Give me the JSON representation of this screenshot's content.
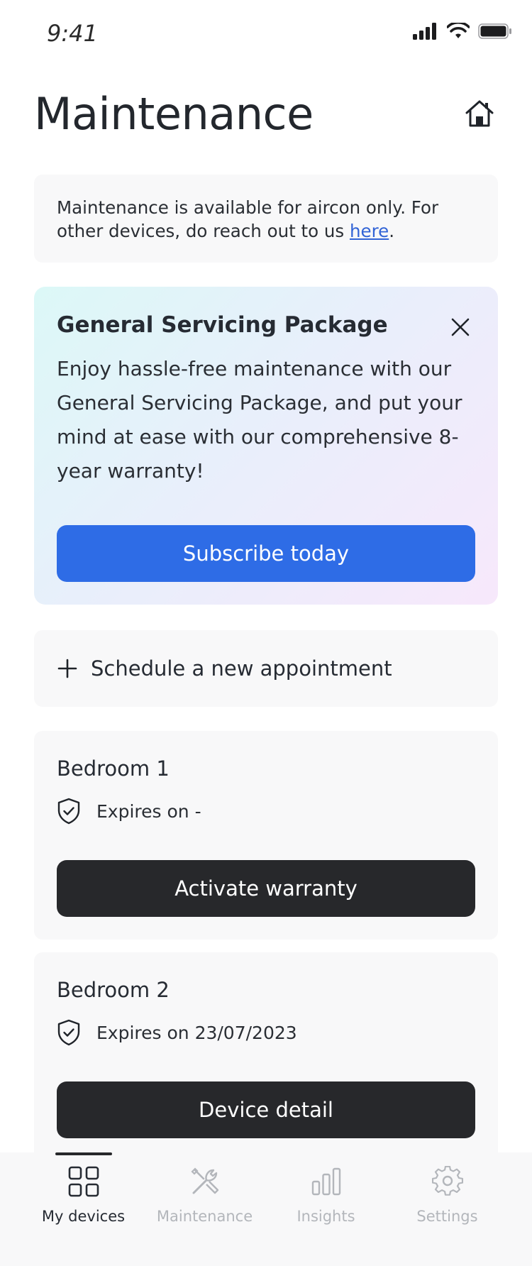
{
  "status_bar": {
    "time": "9:41"
  },
  "header": {
    "title": "Maintenance",
    "home_icon": "home-icon"
  },
  "info_note": {
    "text_before_link": "Maintenance is available for aircon only. For other devices, do reach out to us ",
    "link_text": "here",
    "text_after_link": "."
  },
  "promo": {
    "title": "General Servicing Package",
    "body": "Enjoy hassle-free maintenance with our General Servicing Package, and put your mind at ease with our comprehensive 8-year warranty!",
    "button_label": "Subscribe today",
    "close_icon": "close-icon",
    "colors": {
      "button": "#2e6ce6",
      "gradient_start": "#dcf8f7",
      "gradient_end": "#f7e8fb"
    }
  },
  "schedule": {
    "label": "Schedule a new appointment",
    "icon": "plus-icon"
  },
  "devices": [
    {
      "name": "Bedroom 1",
      "expiry_text": "Expires on -",
      "button_label": "Activate warranty",
      "icon": "shield-check-icon"
    },
    {
      "name": "Bedroom 2",
      "expiry_text": "Expires on 23/07/2023",
      "button_label": "Device detail",
      "icon": "shield-check-icon"
    }
  ],
  "bottom_nav": {
    "active": "My devices",
    "items": [
      {
        "label": "My devices",
        "icon": "grid-icon"
      },
      {
        "label": "Maintenance",
        "icon": "tools-icon"
      },
      {
        "label": "Insights",
        "icon": "bar-chart-icon"
      },
      {
        "label": "Settings",
        "icon": "gear-icon"
      }
    ]
  }
}
